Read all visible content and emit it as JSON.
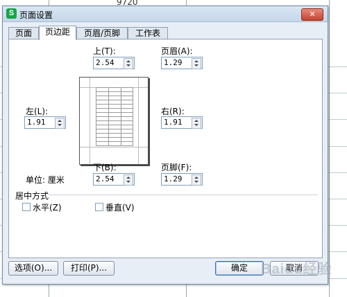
{
  "background": {
    "partial_text": "9720"
  },
  "window": {
    "title": "页面设置",
    "app_icon_letter": "S",
    "close_symbol": "✕"
  },
  "tabs": [
    {
      "label": "页面"
    },
    {
      "label": "页边距"
    },
    {
      "label": "页眉/页脚"
    },
    {
      "label": "工作表"
    }
  ],
  "margins": {
    "top": {
      "label": "上(T):",
      "value": "2.54"
    },
    "header": {
      "label": "页眉(A):",
      "value": "1.29"
    },
    "left": {
      "label": "左(L):",
      "value": "1.91"
    },
    "right": {
      "label": "右(R):",
      "value": "1.91"
    },
    "bottom": {
      "label": "下(B):",
      "value": "2.54"
    },
    "footer": {
      "label": "页脚(F):",
      "value": "1.29"
    },
    "unit_label": "单位: 厘米"
  },
  "center": {
    "group_label": "居中方式",
    "horizontal_label": "水平(Z)",
    "vertical_label": "垂直(V)",
    "horizontal_checked": false,
    "vertical_checked": false
  },
  "buttons": {
    "options": "选项(O)...",
    "print": "打印(P)...",
    "ok": "确定",
    "cancel": "取消"
  },
  "watermark": "Baidu经验",
  "colors": {
    "accent": "#1aa34a",
    "close": "#c8422b"
  }
}
